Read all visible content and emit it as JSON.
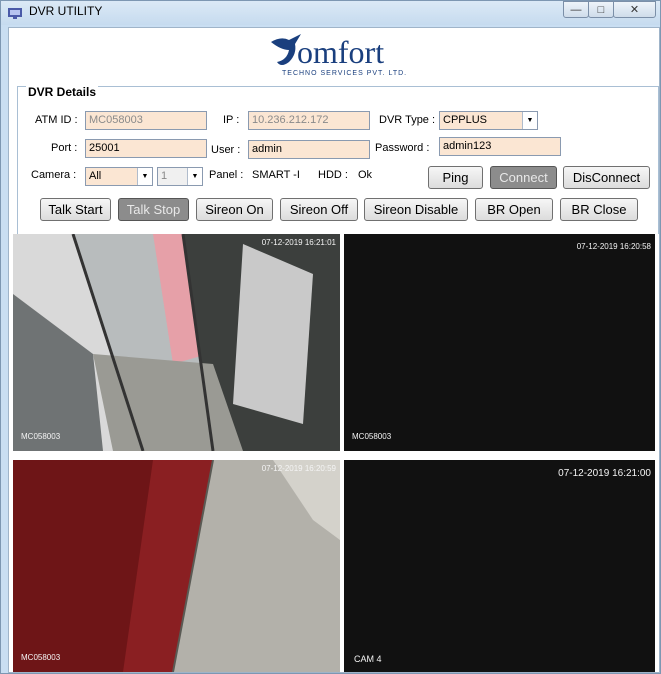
{
  "window": {
    "title": "DVR UTILITY",
    "minimize": "—",
    "maximize": "□",
    "close": "✕"
  },
  "logo": {
    "text": "omfort",
    "subtitle": "TECHNO SERVICES PVT. LTD."
  },
  "details": {
    "title": "DVR Details",
    "atm_label": "ATM ID :",
    "atm_value": "MC058003",
    "ip_label": "IP :",
    "ip_value": "10.236.212.172",
    "dvr_type_label": "DVR Type :",
    "dvr_type_value": "CPPLUS",
    "port_label": "Port :",
    "port_value": "25001",
    "user_label": "User :",
    "user_value": "admin",
    "password_label": "Password :",
    "password_value": "admin123",
    "camera_label": "Camera :",
    "camera_value": "All",
    "channel_value": "1",
    "panel_label": "Panel :",
    "panel_value": "SMART -I",
    "hdd_label": "HDD :",
    "hdd_value": "Ok"
  },
  "buttons": {
    "ping": "Ping",
    "connect": "Connect",
    "disconnect": "DisConnect",
    "talk_start": "Talk Start",
    "talk_stop": "Talk Stop",
    "sireon_on": "Sireon On",
    "sireon_off": "Sireon Off",
    "sireon_disable": "Sireon Disable",
    "br_open": "BR Open",
    "br_close": "BR Close"
  },
  "cameras": [
    {
      "timestamp": "07-12-2019 16:21:01",
      "name": "MC058003"
    },
    {
      "timestamp": "07-12-2019 16:20:58",
      "name": "MC058003"
    },
    {
      "timestamp": "07-12-2019 16:20:59",
      "name": "MC058003"
    },
    {
      "timestamp": "07-12-2019 16:21:00",
      "name": "CAM 4"
    }
  ]
}
